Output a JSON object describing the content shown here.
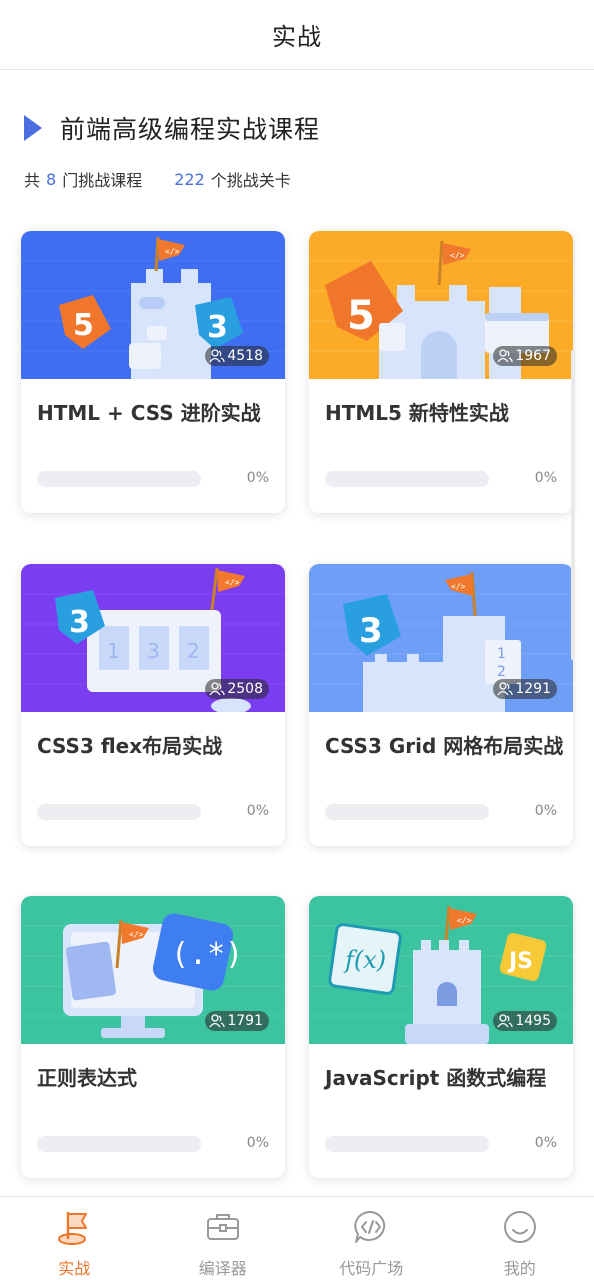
{
  "header": {
    "title": "实战"
  },
  "section": {
    "heading": "前端高级编程实战课程",
    "stats": {
      "prefix1": "共",
      "course_count": "8",
      "suffix1": "门挑战课程",
      "level_count": "222",
      "suffix2": "个挑战关卡"
    }
  },
  "courses": [
    {
      "title": "HTML + CSS 进阶实战",
      "learners": "4518",
      "progress_label": "0%",
      "progress": 0,
      "banner_color": "#3f6ef2"
    },
    {
      "title": "HTML5 新特性实战",
      "learners": "1967",
      "progress_label": "0%",
      "progress": 0,
      "banner_color": "#fbab27"
    },
    {
      "title": "CSS3 flex布局实战",
      "learners": "2508",
      "progress_label": "0%",
      "progress": 0,
      "banner_color": "#7a3df0"
    },
    {
      "title": "CSS3 Grid 网格布局实战",
      "learners": "1291",
      "progress_label": "0%",
      "progress": 0,
      "banner_color": "#6f9ef7"
    },
    {
      "title": "正则表达式",
      "learners": "1791",
      "progress_label": "0%",
      "progress": 0,
      "banner_color": "#3cc3a0"
    },
    {
      "title": "JavaScript 函数式编程",
      "learners": "1495",
      "progress_label": "0%",
      "progress": 0,
      "banner_color": "#3cc3a0"
    }
  ],
  "tabs": [
    {
      "label": "实战",
      "icon": "flag-icon",
      "active": true
    },
    {
      "label": "编译器",
      "icon": "toolbox-icon",
      "active": false
    },
    {
      "label": "代码广场",
      "icon": "code-chat-icon",
      "active": false
    },
    {
      "label": "我的",
      "icon": "profile-icon",
      "active": false
    }
  ],
  "colors": {
    "accent": "#4a6ee0",
    "active_tab": "#f0762b",
    "inactive_tab": "#999999"
  }
}
